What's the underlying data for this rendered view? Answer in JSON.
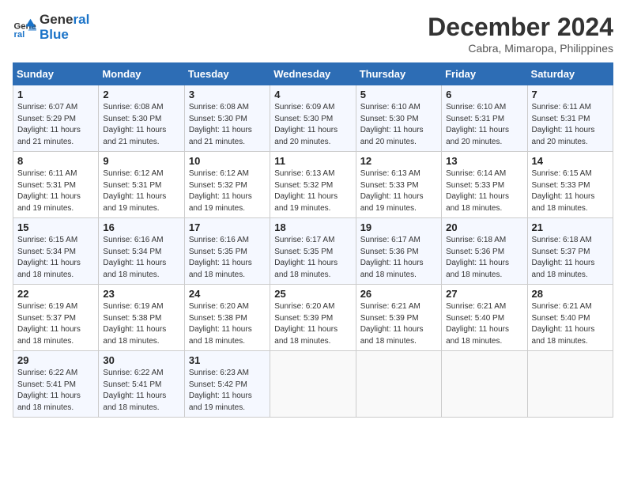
{
  "header": {
    "logo_line1": "General",
    "logo_line2": "Blue",
    "month_title": "December 2024",
    "location": "Cabra, Mimaropa, Philippines"
  },
  "columns": [
    "Sunday",
    "Monday",
    "Tuesday",
    "Wednesday",
    "Thursday",
    "Friday",
    "Saturday"
  ],
  "weeks": [
    [
      {
        "day": "1",
        "sunrise": "Sunrise: 6:07 AM",
        "sunset": "Sunset: 5:29 PM",
        "daylight": "Daylight: 11 hours and 21 minutes."
      },
      {
        "day": "2",
        "sunrise": "Sunrise: 6:08 AM",
        "sunset": "Sunset: 5:30 PM",
        "daylight": "Daylight: 11 hours and 21 minutes."
      },
      {
        "day": "3",
        "sunrise": "Sunrise: 6:08 AM",
        "sunset": "Sunset: 5:30 PM",
        "daylight": "Daylight: 11 hours and 21 minutes."
      },
      {
        "day": "4",
        "sunrise": "Sunrise: 6:09 AM",
        "sunset": "Sunset: 5:30 PM",
        "daylight": "Daylight: 11 hours and 20 minutes."
      },
      {
        "day": "5",
        "sunrise": "Sunrise: 6:10 AM",
        "sunset": "Sunset: 5:30 PM",
        "daylight": "Daylight: 11 hours and 20 minutes."
      },
      {
        "day": "6",
        "sunrise": "Sunrise: 6:10 AM",
        "sunset": "Sunset: 5:31 PM",
        "daylight": "Daylight: 11 hours and 20 minutes."
      },
      {
        "day": "7",
        "sunrise": "Sunrise: 6:11 AM",
        "sunset": "Sunset: 5:31 PM",
        "daylight": "Daylight: 11 hours and 20 minutes."
      }
    ],
    [
      {
        "day": "8",
        "sunrise": "Sunrise: 6:11 AM",
        "sunset": "Sunset: 5:31 PM",
        "daylight": "Daylight: 11 hours and 19 minutes."
      },
      {
        "day": "9",
        "sunrise": "Sunrise: 6:12 AM",
        "sunset": "Sunset: 5:31 PM",
        "daylight": "Daylight: 11 hours and 19 minutes."
      },
      {
        "day": "10",
        "sunrise": "Sunrise: 6:12 AM",
        "sunset": "Sunset: 5:32 PM",
        "daylight": "Daylight: 11 hours and 19 minutes."
      },
      {
        "day": "11",
        "sunrise": "Sunrise: 6:13 AM",
        "sunset": "Sunset: 5:32 PM",
        "daylight": "Daylight: 11 hours and 19 minutes."
      },
      {
        "day": "12",
        "sunrise": "Sunrise: 6:13 AM",
        "sunset": "Sunset: 5:33 PM",
        "daylight": "Daylight: 11 hours and 19 minutes."
      },
      {
        "day": "13",
        "sunrise": "Sunrise: 6:14 AM",
        "sunset": "Sunset: 5:33 PM",
        "daylight": "Daylight: 11 hours and 18 minutes."
      },
      {
        "day": "14",
        "sunrise": "Sunrise: 6:15 AM",
        "sunset": "Sunset: 5:33 PM",
        "daylight": "Daylight: 11 hours and 18 minutes."
      }
    ],
    [
      {
        "day": "15",
        "sunrise": "Sunrise: 6:15 AM",
        "sunset": "Sunset: 5:34 PM",
        "daylight": "Daylight: 11 hours and 18 minutes."
      },
      {
        "day": "16",
        "sunrise": "Sunrise: 6:16 AM",
        "sunset": "Sunset: 5:34 PM",
        "daylight": "Daylight: 11 hours and 18 minutes."
      },
      {
        "day": "17",
        "sunrise": "Sunrise: 6:16 AM",
        "sunset": "Sunset: 5:35 PM",
        "daylight": "Daylight: 11 hours and 18 minutes."
      },
      {
        "day": "18",
        "sunrise": "Sunrise: 6:17 AM",
        "sunset": "Sunset: 5:35 PM",
        "daylight": "Daylight: 11 hours and 18 minutes."
      },
      {
        "day": "19",
        "sunrise": "Sunrise: 6:17 AM",
        "sunset": "Sunset: 5:36 PM",
        "daylight": "Daylight: 11 hours and 18 minutes."
      },
      {
        "day": "20",
        "sunrise": "Sunrise: 6:18 AM",
        "sunset": "Sunset: 5:36 PM",
        "daylight": "Daylight: 11 hours and 18 minutes."
      },
      {
        "day": "21",
        "sunrise": "Sunrise: 6:18 AM",
        "sunset": "Sunset: 5:37 PM",
        "daylight": "Daylight: 11 hours and 18 minutes."
      }
    ],
    [
      {
        "day": "22",
        "sunrise": "Sunrise: 6:19 AM",
        "sunset": "Sunset: 5:37 PM",
        "daylight": "Daylight: 11 hours and 18 minutes."
      },
      {
        "day": "23",
        "sunrise": "Sunrise: 6:19 AM",
        "sunset": "Sunset: 5:38 PM",
        "daylight": "Daylight: 11 hours and 18 minutes."
      },
      {
        "day": "24",
        "sunrise": "Sunrise: 6:20 AM",
        "sunset": "Sunset: 5:38 PM",
        "daylight": "Daylight: 11 hours and 18 minutes."
      },
      {
        "day": "25",
        "sunrise": "Sunrise: 6:20 AM",
        "sunset": "Sunset: 5:39 PM",
        "daylight": "Daylight: 11 hours and 18 minutes."
      },
      {
        "day": "26",
        "sunrise": "Sunrise: 6:21 AM",
        "sunset": "Sunset: 5:39 PM",
        "daylight": "Daylight: 11 hours and 18 minutes."
      },
      {
        "day": "27",
        "sunrise": "Sunrise: 6:21 AM",
        "sunset": "Sunset: 5:40 PM",
        "daylight": "Daylight: 11 hours and 18 minutes."
      },
      {
        "day": "28",
        "sunrise": "Sunrise: 6:21 AM",
        "sunset": "Sunset: 5:40 PM",
        "daylight": "Daylight: 11 hours and 18 minutes."
      }
    ],
    [
      {
        "day": "29",
        "sunrise": "Sunrise: 6:22 AM",
        "sunset": "Sunset: 5:41 PM",
        "daylight": "Daylight: 11 hours and 18 minutes."
      },
      {
        "day": "30",
        "sunrise": "Sunrise: 6:22 AM",
        "sunset": "Sunset: 5:41 PM",
        "daylight": "Daylight: 11 hours and 18 minutes."
      },
      {
        "day": "31",
        "sunrise": "Sunrise: 6:23 AM",
        "sunset": "Sunset: 5:42 PM",
        "daylight": "Daylight: 11 hours and 19 minutes."
      },
      null,
      null,
      null,
      null
    ]
  ]
}
